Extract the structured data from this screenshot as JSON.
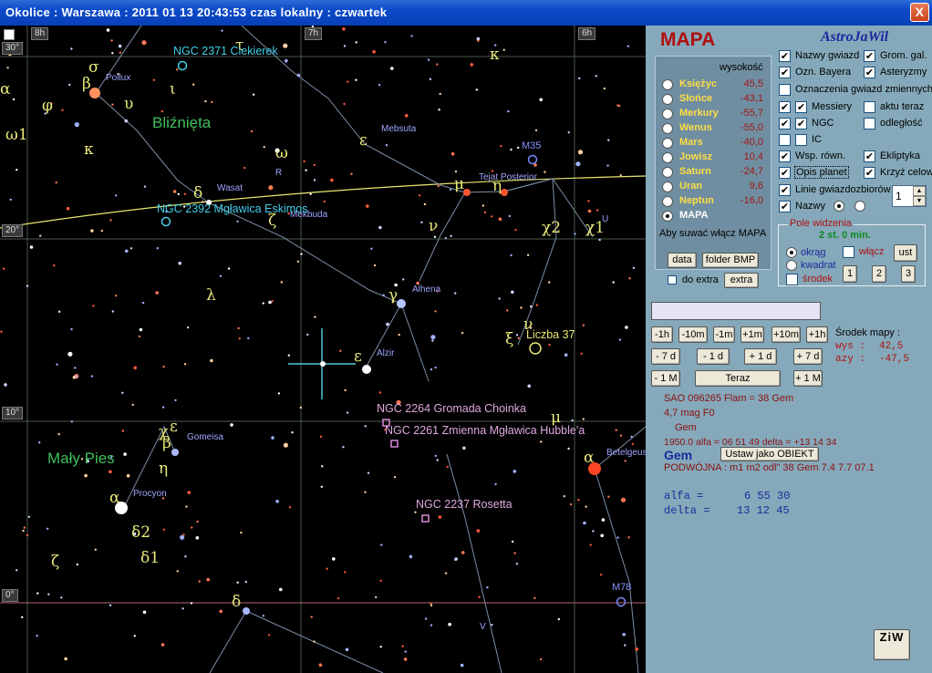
{
  "window": {
    "title": "Okolice  :  Warszawa  :  2011 01 13  20:43:53  czas lokalny  :  czwartek",
    "close": "X"
  },
  "sky": {
    "ra_ticks": [
      "8h",
      "7h",
      "6h"
    ],
    "dec_ticks": [
      "30°",
      "20°",
      "10°",
      "0°"
    ],
    "constellations": [
      "Bliźnięta",
      "Mały Pies"
    ],
    "greek": [
      "σ",
      "β",
      "υ",
      "ι",
      "τ",
      "κ",
      "φ",
      "ω1",
      "κ",
      "ω",
      "δ",
      "ζ",
      "ε",
      "μ",
      "η",
      "ν",
      "χ2",
      "χ1",
      "λ",
      "γ",
      "ν",
      "ξ",
      "ε",
      "ξ",
      "μ",
      "χ",
      "ε",
      "β",
      "η",
      "α",
      "α",
      "β",
      "δ2",
      "δ1",
      "ζ",
      "δ",
      "α",
      "ε",
      "U",
      "R"
    ],
    "star_names": [
      "Pollux",
      "Mebsuta",
      "M35",
      "Wasat",
      "Mekbuda",
      "Tejat Posterior",
      "Alhena",
      "Alzir",
      "Gomeisa",
      "Procyon",
      "Betelgeuse",
      "M78",
      "V"
    ],
    "dso": [
      "NGC  2371  Ciekierek",
      "NGC  2392  Mgławica Eskimos",
      "Liczba 37",
      "NGC  2264  Gromada Choinka",
      "NGC  2261  Zmienna Mgławica Hubble'a",
      "NGC  2237  Rosetta"
    ],
    "markers": [
      "R"
    ]
  },
  "panel": {
    "title": "MAPA",
    "brand": "AstroJaWil",
    "height_header": "wysokość",
    "planets": [
      {
        "name": "Księżyc",
        "value": "45,5"
      },
      {
        "name": "Słońce",
        "value": "-43,1"
      },
      {
        "name": "Merkury",
        "value": "-55,7"
      },
      {
        "name": "Wenus",
        "value": "-55,0"
      },
      {
        "name": "Mars",
        "value": "-40,0"
      },
      {
        "name": "Jowisz",
        "value": "10,4"
      },
      {
        "name": "Saturn",
        "value": "-24,7"
      },
      {
        "name": "Uran",
        "value": "9,6"
      },
      {
        "name": "Neptun",
        "value": "-16,0"
      },
      {
        "name": "MAPA",
        "value": ""
      }
    ],
    "planets_hint": "Aby suwać włącz MAPA",
    "checks": {
      "nazwy_gwiazd": "Nazwy gwiazd",
      "grom_gal": "Grom. gal.",
      "ozn_bayera": "Ozn. Bayera",
      "asteryzmy": "Asteryzmy",
      "ozn_zmiennych": "Oznaczenia gwiazd zmiennych",
      "messiery": "Messiery",
      "aktu_teraz": "aktu teraz",
      "ngc": "NGC",
      "odleglosc": "odległość",
      "ic": "IC",
      "wsp_rown": "Wsp. równ.",
      "ekliptyka": "Ekliptyka",
      "opis_planet": "Opis planet",
      "krzyz": "Krzyż celow.",
      "linie": "Linie gwiazdozbiorów",
      "nazwy": "Nazwy"
    },
    "spin_value": "1",
    "fov": {
      "title": "Pole widzenia",
      "value": "2 st.  0 min.",
      "okrag": "okrąg",
      "kwadrat": "kwadrat",
      "wlacz": "włącz",
      "srodek": "środek",
      "ust": "ust",
      "b1": "1",
      "b2": "2",
      "b3": "3"
    },
    "buttons": {
      "data": "data",
      "folder": "folder BMP",
      "do_extra": "do extra",
      "extra": "extra"
    },
    "search_value": "",
    "time_buttons": [
      "-1h",
      "-10m",
      "-1m",
      "+1m",
      "+10m",
      "+1h",
      "- 7 d",
      "- 1 d",
      "+ 1 d",
      "+ 7 d",
      "- 1 M",
      "Teraz",
      "+ 1 M"
    ],
    "center": {
      "label": "Środek mapy :",
      "wys_label": "wys  :",
      "wys": "42,5",
      "azy_label": "azy  :",
      "azy": "-47,5"
    },
    "info": {
      "line1": "SAO 096265  Flam = 38 Gem",
      "line2": "4,7 mag  F0",
      "line3": "Gem",
      "line4": "1950.0   alfa = 06 51 49    delta = +13 14 34",
      "gem": "Gem",
      "set_obj": "Ustaw jako OBIEKT",
      "line5": "PODWÓJNA : m1 m2 odl\"  38 Gem  7.4 7.7 07.1",
      "alfa_label": "alfa  =",
      "alfa": "6  55  30",
      "delta_label": "delta =",
      "delta": "13  12  45"
    },
    "ziw": "ZiW"
  }
}
